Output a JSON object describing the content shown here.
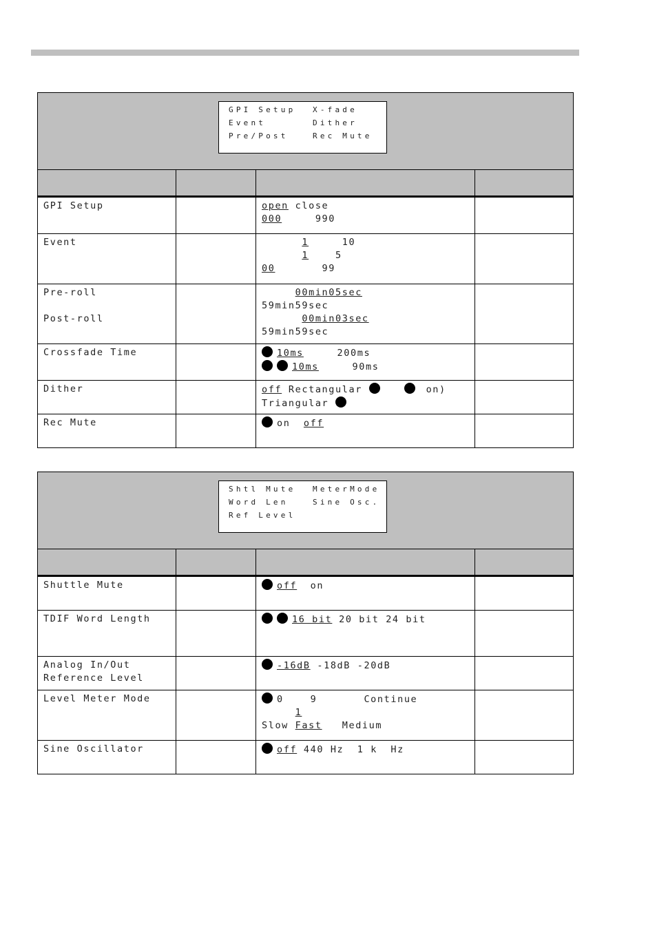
{
  "decor": {
    "top_bar_color": "#bfbfbf",
    "panel_header_color": "#bfbfbf"
  },
  "panel1": {
    "lcd": [
      [
        "GPI Setup",
        "X-fade"
      ],
      [
        "Event",
        "Dither"
      ],
      [
        "Pre/Post",
        "Rec Mute"
      ]
    ],
    "rows": [
      {
        "name": "GPI Setup",
        "lines": [
          [
            {
              "t": "open",
              "u": true
            },
            {
              "t": " close"
            }
          ],
          [
            {
              "t": "000",
              "u": true
            },
            {
              "t": "     990"
            }
          ]
        ]
      },
      {
        "name": "Event",
        "lines": [
          [
            {
              "t": "      "
            },
            {
              "t": "1",
              "u": true
            },
            {
              "t": "     10"
            }
          ],
          [
            {
              "t": "      "
            },
            {
              "t": "1",
              "u": true
            },
            {
              "t": "    5"
            }
          ],
          [
            {
              "t": "00",
              "u": true
            },
            {
              "t": "       99"
            }
          ]
        ]
      },
      {
        "name": "Pre-roll\n\nPost-roll",
        "lines": [
          [
            {
              "t": "     "
            },
            {
              "t": "00min05sec",
              "u": true
            }
          ],
          [
            {
              "t": "59min59sec"
            }
          ],
          [
            {
              "t": "      "
            },
            {
              "t": "00min03sec",
              "u": true
            }
          ],
          [
            {
              "t": "59min59sec"
            }
          ]
        ]
      },
      {
        "name": "Crossfade Time",
        "lines": [
          [
            {
              "dot": 1
            },
            {
              "t": "10ms",
              "u": true
            },
            {
              "t": "     200ms"
            }
          ],
          [
            {
              "dot": 2
            },
            {
              "t": "10ms",
              "u": true
            },
            {
              "t": "     90ms"
            }
          ]
        ]
      },
      {
        "name": "Dither",
        "lines": [
          [
            {
              "t": "off",
              "u": true
            },
            {
              "t": " Rectangular "
            },
            {
              "dot": 1
            },
            {
              "t": "   "
            },
            {
              "dot": 1
            },
            {
              "t": " on)"
            }
          ],
          [
            {
              "t": "Triangular "
            },
            {
              "dot": 1
            }
          ]
        ]
      },
      {
        "name": "Rec Mute",
        "lines": [
          [
            {
              "dot": 1
            },
            {
              "t": "on  "
            },
            {
              "t": "off",
              "u": true
            }
          ]
        ]
      }
    ]
  },
  "panel2": {
    "lcd": [
      [
        "Shtl Mute",
        "MeterMode"
      ],
      [
        "Word Len",
        "Sine Osc."
      ],
      [
        "Ref Level",
        ""
      ]
    ],
    "rows": [
      {
        "name": "Shuttle Mute",
        "lines": [
          [
            {
              "dot": 1
            },
            {
              "t": "off",
              "u": true
            },
            {
              "t": "  on"
            }
          ]
        ]
      },
      {
        "name": "TDIF Word Length",
        "lines": [
          [
            {
              "dot": 2
            },
            {
              "t": "16 bit",
              "u": true
            },
            {
              "t": " 20 bit 24 bit"
            }
          ]
        ]
      },
      {
        "name": "Analog In/Out\nReference Level",
        "lines": [
          [
            {
              "dot": 1
            },
            {
              "t": "-16dB",
              "u": true
            },
            {
              "t": " -18dB -20dB"
            }
          ]
        ]
      },
      {
        "name": "Level Meter Mode",
        "lines": [
          [
            {
              "dot": 1
            },
            {
              "t": "0    9       Continue"
            }
          ],
          [
            {
              "t": "     "
            },
            {
              "t": "1",
              "u": true
            }
          ],
          [
            {
              "t": "Slow "
            },
            {
              "t": "Fast",
              "u": true
            },
            {
              "t": "   Medium"
            }
          ]
        ]
      },
      {
        "name": "Sine Oscillator",
        "lines": [
          [
            {
              "dot": 1
            },
            {
              "t": "off",
              "u": true
            },
            {
              "t": " 440 Hz  1 k  Hz"
            }
          ]
        ]
      }
    ]
  }
}
